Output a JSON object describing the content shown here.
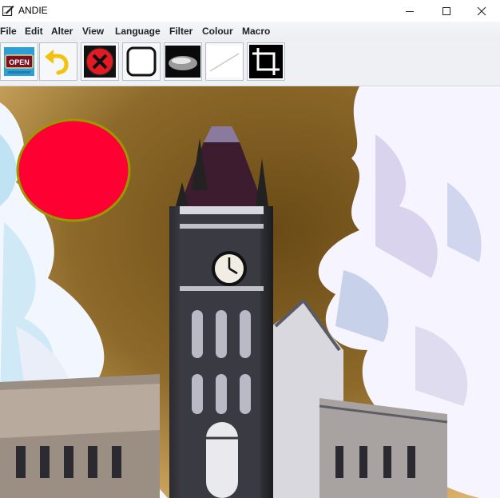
{
  "window": {
    "title": "ANDIE"
  },
  "menu": {
    "file": "File",
    "edit": "Edit",
    "alter": "Alter",
    "view": "View",
    "language": "Language",
    "filter": "Filter",
    "colour": "Colour",
    "macro": "Macro"
  },
  "toolbar": {
    "open_icon_text": "OPEN",
    "buttons": [
      "open-file-icon",
      "undo-icon",
      "close-icon",
      "rectangle-icon",
      "ellipse-icon",
      "line-icon",
      "crop-icon"
    ]
  },
  "canvas": {
    "shape_fill": "#ff0033",
    "shape_stroke": "#9a9a00",
    "sky_color": "#7e5a1e"
  }
}
